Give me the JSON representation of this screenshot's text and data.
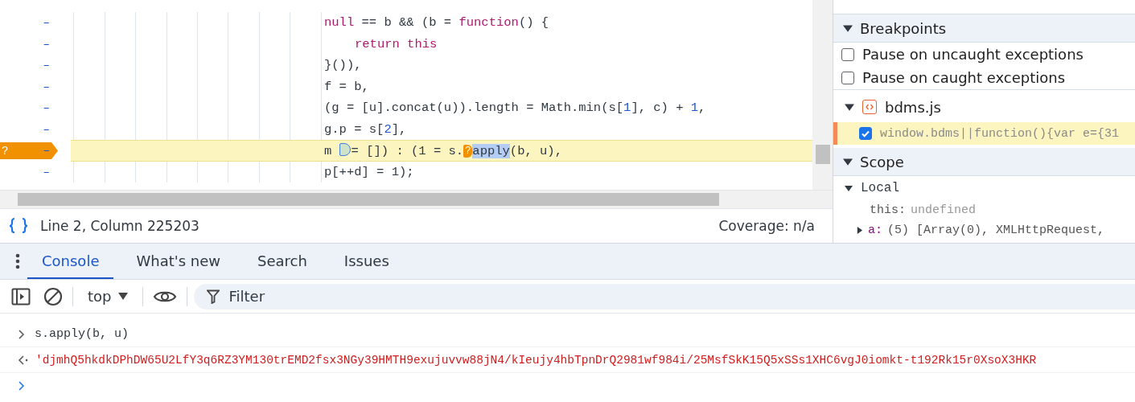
{
  "editor": {
    "lines": [
      {
        "gutter": "–",
        "breakpoint": false,
        "current": false,
        "indent": false,
        "segments": [
          {
            "text": "null",
            "kind": "keyword"
          },
          {
            "text": " == b && (b = ",
            "kind": "plain"
          },
          {
            "text": "function",
            "kind": "keyword"
          },
          {
            "text": "() {",
            "kind": "plain"
          }
        ]
      },
      {
        "gutter": "–",
        "breakpoint": false,
        "current": false,
        "indent": true,
        "segments": [
          {
            "text": "return this",
            "kind": "keyword"
          }
        ]
      },
      {
        "gutter": "–",
        "breakpoint": false,
        "current": false,
        "indent": false,
        "segments": [
          {
            "text": "}()),",
            "kind": "plain"
          }
        ]
      },
      {
        "gutter": "–",
        "breakpoint": false,
        "current": false,
        "indent": false,
        "segments": [
          {
            "text": "f = b,",
            "kind": "plain"
          }
        ]
      },
      {
        "gutter": "–",
        "breakpoint": false,
        "current": false,
        "indent": false,
        "segments": [
          {
            "text": "(g = [u].concat(u)).length = Math.min(s[",
            "kind": "plain"
          },
          {
            "text": "1",
            "kind": "number"
          },
          {
            "text": "], c) + ",
            "kind": "plain"
          },
          {
            "text": "1",
            "kind": "number"
          },
          {
            "text": ",",
            "kind": "plain"
          }
        ]
      },
      {
        "gutter": "–",
        "breakpoint": false,
        "current": false,
        "indent": false,
        "segments": [
          {
            "text": "g.p = s[",
            "kind": "plain"
          },
          {
            "text": "2",
            "kind": "number"
          },
          {
            "text": "],",
            "kind": "plain"
          }
        ]
      },
      {
        "gutter": "–",
        "breakpoint": true,
        "breakpoint_mark": "?",
        "current": true,
        "indent": false,
        "segments": [
          {
            "text": "m ",
            "kind": "plain"
          },
          {
            "kind": "inline-breakpoint"
          },
          {
            "text": "= []) : (1 = s.",
            "kind": "plain"
          },
          {
            "text": "?",
            "kind": "conditional-breakpoint"
          },
          {
            "text": "apply",
            "kind": "selected"
          },
          {
            "text": "(b, u),",
            "kind": "plain"
          }
        ]
      },
      {
        "gutter": "–",
        "breakpoint": false,
        "current": false,
        "indent": false,
        "segments": [
          {
            "text": "p[++d] = 1);",
            "kind": "plain"
          }
        ]
      }
    ]
  },
  "status_bar": {
    "cursor": "Line 2, Column 225203",
    "coverage": "Coverage: n/a"
  },
  "sidebar": {
    "items": [
      {
        "kind": "header",
        "title": "Breakpoints",
        "expanded": true
      },
      {
        "kind": "checkbox",
        "label": "Pause on uncaught exceptions",
        "checked": false
      },
      {
        "kind": "checkbox",
        "label": "Pause on caught exceptions",
        "checked": false
      },
      {
        "kind": "file",
        "name": "bdms.js",
        "expanded": true
      },
      {
        "kind": "breakpoint",
        "code": "window.bdms||function(){var e={31",
        "checked": true
      },
      {
        "kind": "header",
        "title": "Scope",
        "expanded": true
      },
      {
        "kind": "scope",
        "title": "Local",
        "expanded": true
      },
      {
        "kind": "property",
        "name": "this:",
        "value": "undefined",
        "expandable": false
      },
      {
        "kind": "property",
        "name": "a:",
        "value": "(5) [Array(0), XMLHttpRequest,",
        "expandable": true
      }
    ]
  },
  "drawer": {
    "tabs": [
      {
        "label": "Console",
        "selected": true
      },
      {
        "label": "What's new",
        "selected": false
      },
      {
        "label": "Search",
        "selected": false
      },
      {
        "label": "Issues",
        "selected": false
      }
    ],
    "toolbar": {
      "context": "top",
      "filter_placeholder": "Filter"
    },
    "console": [
      {
        "kind": "input",
        "text": "s.apply(b, u)"
      },
      {
        "kind": "result",
        "text": "'djmhQ5hkdkDPhDW65U2LfY3q6RZ3YM130trEMD2fsx3NGy39HMTH9exujuvvw88jN4/kIeujy4hbTpnDrQ2981wf984i/25MsfSkK15Q5xSSs1XHC6vgJ0iomkt-t192Rk15r0XsoX3HKR"
      },
      {
        "kind": "prompt"
      }
    ]
  }
}
